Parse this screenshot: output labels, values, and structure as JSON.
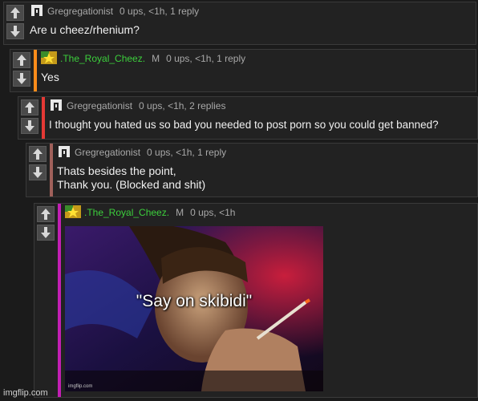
{
  "comments": [
    {
      "user": "Gregregationist",
      "meta": "0 ups, <1h, 1 reply",
      "text": "Are u cheez/rhenium?",
      "bar_color": ""
    },
    {
      "user": ".The_Royal_Cheez.",
      "mod": "M",
      "meta": "0 ups, <1h, 1 reply",
      "text": "Yes",
      "bar_color": "#ff8c1a"
    },
    {
      "user": "Gregregationist",
      "meta": "0 ups, <1h, 2 replies",
      "text": "I thought you hated us so bad you needed to post porn so you could get banned?",
      "bar_color": "#e53935"
    },
    {
      "user": "Gregregationist",
      "meta": "0 ups, <1h, 1 reply",
      "text": "Thats besides the point,\nThank you. (Blocked and shit)",
      "bar_color": "#a0605a"
    },
    {
      "user": ".The_Royal_Cheez.",
      "mod": "M",
      "meta": "0 ups, <1h",
      "text": "",
      "bar_color": "#c21fb4",
      "image": {
        "caption": "\"Say on skibidi\"",
        "watermark": "imgflip.com"
      }
    }
  ],
  "icons": {
    "upvote": "arrow-up-icon",
    "downvote": "arrow-down-icon",
    "avatar_grey": "pixel-avatar-icon",
    "avatar_cheez": "star-avatar-icon"
  },
  "site_watermark": "imgflip.com"
}
